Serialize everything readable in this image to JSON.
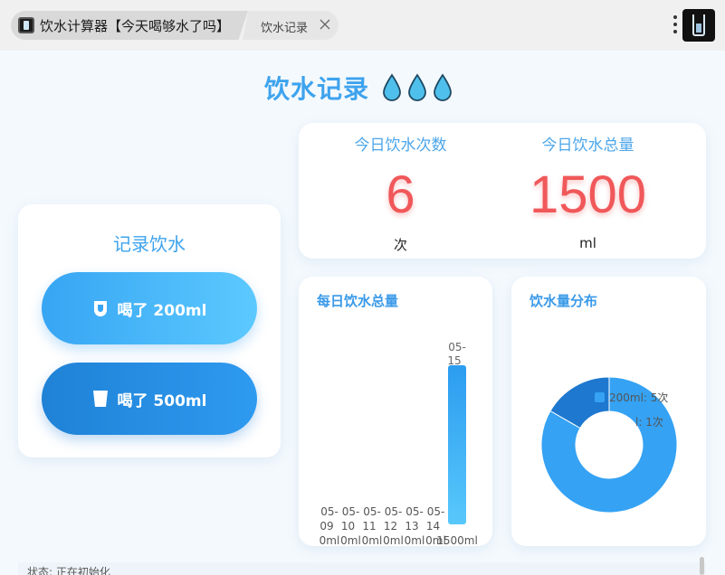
{
  "browser": {
    "active_tab_title": "饮水计算器【今天喝够水了吗】",
    "second_tab_label": "饮水记录"
  },
  "page": {
    "title": "饮水记录"
  },
  "record": {
    "title": "记录饮水",
    "btn_200": "喝了 200ml",
    "btn_500": "喝了 500ml"
  },
  "stats": {
    "count_label": "今日饮水次数",
    "count_value": "6",
    "count_unit": "次",
    "total_label": "今日饮水总量",
    "total_value": "1500",
    "total_unit": "ml"
  },
  "bar_chart_title": "每日饮水总量",
  "pie_chart_title": "饮水量分布",
  "status": {
    "text": "状态: 正在初始化"
  },
  "colors": {
    "accent": "#3ea3ee",
    "value_red": "#f0585a",
    "bar": "#3fb4f6",
    "pie_main": "#35a2f4",
    "pie_second": "#1e78cf"
  },
  "chart_data": [
    {
      "type": "bar",
      "title": "每日饮水总量",
      "categories": [
        "05-09",
        "05-10",
        "05-11",
        "05-12",
        "05-13",
        "05-14",
        "05-15"
      ],
      "values": [
        0,
        0,
        0,
        0,
        0,
        0,
        1500
      ],
      "value_labels": [
        "0ml",
        "0ml",
        "0ml",
        "0ml",
        "0ml",
        "0ml",
        "1500ml"
      ]
    },
    {
      "type": "pie",
      "title": "饮水量分布",
      "labels": [
        "200ml: 5次",
        "500ml: 1次"
      ],
      "values": [
        5,
        1
      ],
      "legend_labels": [
        "200ml: 5次",
        "l: 1次"
      ]
    }
  ]
}
